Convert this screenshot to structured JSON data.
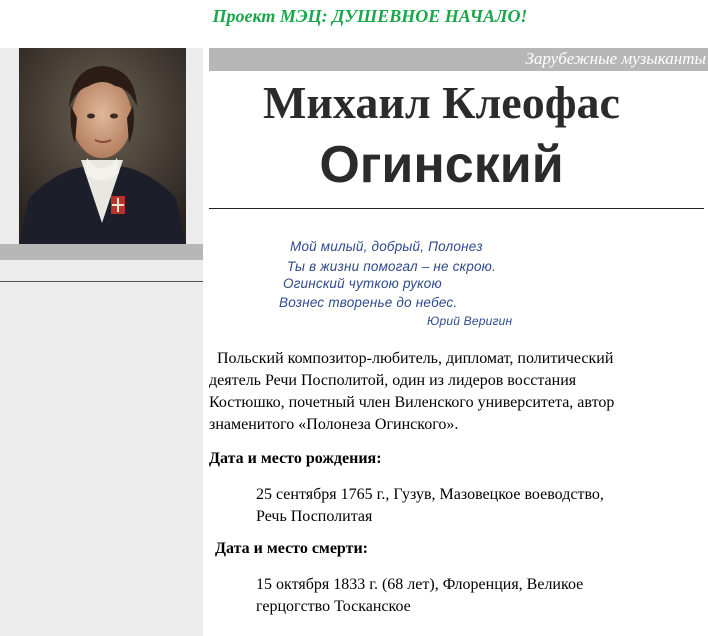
{
  "header": {
    "site_title": "Проект МЭЦ: ДУШЕВНОЕ НАЧАЛО!"
  },
  "category": "Зарубежные музыканты",
  "person": {
    "first_name": "Михаил Клеофас",
    "last_name": "Огинский"
  },
  "poem": {
    "lines": [
      "Мой милый, добрый, Полонез",
      "Ты в жизни помогал – не скрою.",
      "Огинский чуткою рукою",
      "Вознес творенье до небес."
    ],
    "author": "Юрий Веригин"
  },
  "bio": {
    "text_lines": [
      "  Польский композитор-любитель, дипломат, политический",
      "деятель Речи Посполитой, один из лидеров восстания",
      "Костюшко, почетный член Виленского университета, автор",
      "знаменитого «Полонеза Огинского»."
    ]
  },
  "birth": {
    "label": "Дата и место рождения:",
    "lines": [
      "25 сентября 1765 г., Гузув, Мазовецкое воеводство,",
      "Речь Посполитая"
    ]
  },
  "death": {
    "label": "Дата и место смерти:",
    "lines": [
      "15 октября 1833 г. (68 лет),  Флоренция, Великое",
      "герцогство Тосканское"
    ]
  }
}
